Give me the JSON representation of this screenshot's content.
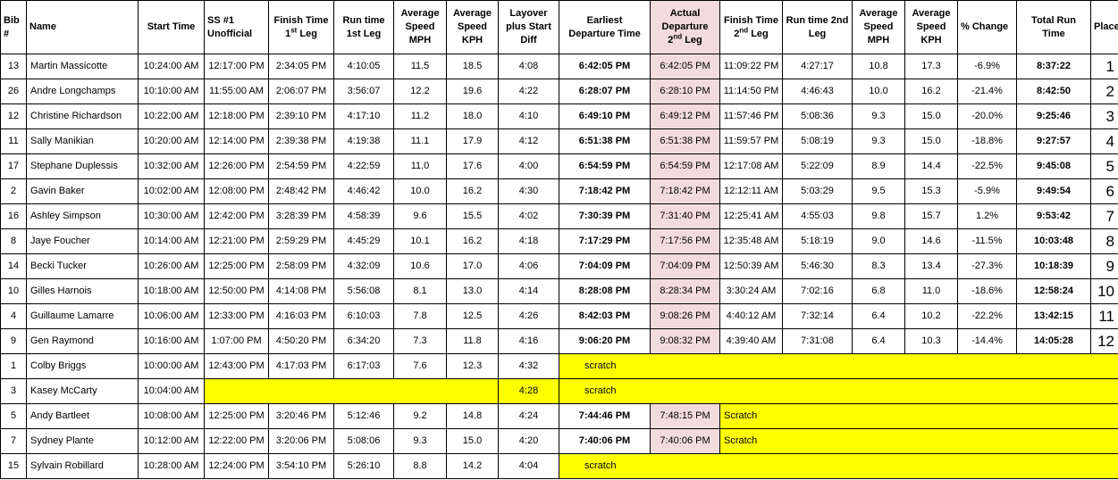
{
  "headers": [
    {
      "line1": "Bib",
      "line2": "#"
    },
    {
      "line1": "Name",
      "line2": ""
    },
    {
      "line1": "Start Time",
      "line2": ""
    },
    {
      "line1": "SS #1",
      "line2": "Unofficial"
    },
    {
      "line1": "Finish Time",
      "line2": "1",
      "sup": "st",
      "rest": " Leg"
    },
    {
      "line1": "Run time",
      "line2": "1st Leg"
    },
    {
      "line1": "Average",
      "line2": "Speed",
      "line3": "MPH"
    },
    {
      "line1": "Average",
      "line2": "Speed",
      "line3": "KPH"
    },
    {
      "line1": "Layover",
      "line2": "plus Start",
      "line3": "Diff"
    },
    {
      "line1": "Earliest",
      "line2": "Departure Time"
    },
    {
      "line1": "Actual",
      "line2": "Departure",
      "line3": "2",
      "sup": "nd",
      "rest": " Leg"
    },
    {
      "line1": "Finish Time",
      "line2": "2",
      "sup": "nd",
      "rest": " Leg"
    },
    {
      "line1": "Run time 2nd",
      "line2": "Leg"
    },
    {
      "line1": "Average",
      "line2": "Speed",
      "line3": "MPH"
    },
    {
      "line1": "Average",
      "line2": "Speed",
      "line3": "KPH"
    },
    {
      "line1": "% Change",
      "line2": ""
    },
    {
      "line1": "Total Run",
      "line2": "Time"
    },
    {
      "line1": "Place",
      "line2": ""
    }
  ],
  "rows": [
    {
      "bib": "13",
      "name": "Martin Massicotte",
      "start": "10:24:00 AM",
      "ss1": "12:17:00 PM",
      "fin1": "2:34:05 PM",
      "run1": "4:10:05",
      "mph1": "11.5",
      "kph1": "18.5",
      "layover": "4:08",
      "earliest": "6:42:05 PM",
      "actual": "6:42:05 PM",
      "fin2": "11:09:22 PM",
      "run2": "4:27:17",
      "mph2": "10.8",
      "kph2": "17.3",
      "change": "-6.9%",
      "total": "8:37:22",
      "place": "1"
    },
    {
      "bib": "26",
      "name": "Andre Longchamps",
      "start": "10:10:00 AM",
      "ss1": "11:55:00 AM",
      "fin1": "2:06:07 PM",
      "run1": "3:56:07",
      "mph1": "12.2",
      "kph1": "19.6",
      "layover": "4:22",
      "earliest": "6:28:07 PM",
      "actual": "6:28:10 PM",
      "fin2": "11:14:50 PM",
      "run2": "4:46:43",
      "mph2": "10.0",
      "kph2": "16.2",
      "change": "-21.4%",
      "total": "8:42:50",
      "place": "2"
    },
    {
      "bib": "12",
      "name": "Christine Richardson",
      "start": "10:22:00 AM",
      "ss1": "12:18:00 PM",
      "fin1": "2:39:10 PM",
      "run1": "4:17:10",
      "mph1": "11.2",
      "kph1": "18.0",
      "layover": "4:10",
      "earliest": "6:49:10 PM",
      "actual": "6:49:12 PM",
      "fin2": "11:57:46 PM",
      "run2": "5:08:36",
      "mph2": "9.3",
      "kph2": "15.0",
      "change": "-20.0%",
      "total": "9:25:46",
      "place": "3"
    },
    {
      "bib": "11",
      "name": "Sally Manikian",
      "start": "10:20:00 AM",
      "ss1": "12:14:00 PM",
      "fin1": "2:39:38 PM",
      "run1": "4:19:38",
      "mph1": "11.1",
      "kph1": "17.9",
      "layover": "4:12",
      "earliest": "6:51:38 PM",
      "actual": "6:51:38 PM",
      "fin2": "11:59:57 PM",
      "run2": "5:08:19",
      "mph2": "9.3",
      "kph2": "15.0",
      "change": "-18.8%",
      "total": "9:27:57",
      "place": "4"
    },
    {
      "bib": "17",
      "name": "Stephane Duplessis",
      "start": "10:32:00 AM",
      "ss1": "12:26:00 PM",
      "fin1": "2:54:59 PM",
      "run1": "4:22:59",
      "mph1": "11.0",
      "kph1": "17.6",
      "layover": "4:00",
      "earliest": "6:54:59 PM",
      "actual": "6:54:59 PM",
      "fin2": "12:17:08 AM",
      "run2": "5:22:09",
      "mph2": "8.9",
      "kph2": "14.4",
      "change": "-22.5%",
      "total": "9:45:08",
      "place": "5"
    },
    {
      "bib": "2",
      "name": "Gavin Baker",
      "start": "10:02:00 AM",
      "ss1": "12:08:00 PM",
      "fin1": "2:48:42 PM",
      "run1": "4:46:42",
      "mph1": "10.0",
      "kph1": "16.2",
      "layover": "4:30",
      "earliest": "7:18:42 PM",
      "actual": "7:18:42 PM",
      "fin2": "12:12:11 AM",
      "run2": "5:03:29",
      "mph2": "9.5",
      "kph2": "15.3",
      "change": "-5.9%",
      "total": "9:49:54",
      "place": "6"
    },
    {
      "bib": "16",
      "name": "Ashley Simpson",
      "start": "10:30:00 AM",
      "ss1": "12:42:00 PM",
      "fin1": "3:28:39 PM",
      "run1": "4:58:39",
      "mph1": "9.6",
      "kph1": "15.5",
      "layover": "4:02",
      "earliest": "7:30:39 PM",
      "actual": "7:31:40 PM",
      "fin2": "12:25:41 AM",
      "run2": "4:55:03",
      "mph2": "9.8",
      "kph2": "15.7",
      "change": "1.2%",
      "total": "9:53:42",
      "place": "7"
    },
    {
      "bib": "8",
      "name": "Jaye Foucher",
      "start": "10:14:00 AM",
      "ss1": "12:21:00 PM",
      "fin1": "2:59:29 PM",
      "run1": "4:45:29",
      "mph1": "10.1",
      "kph1": "16.2",
      "layover": "4:18",
      "earliest": "7:17:29 PM",
      "actual": "7:17:56 PM",
      "fin2": "12:35:48 AM",
      "run2": "5:18:19",
      "mph2": "9.0",
      "kph2": "14.6",
      "change": "-11.5%",
      "total": "10:03:48",
      "place": "8"
    },
    {
      "bib": "14",
      "name": "Becki Tucker",
      "start": "10:26:00 AM",
      "ss1": "12:25:00 PM",
      "fin1": "2:58:09 PM",
      "run1": "4:32:09",
      "mph1": "10.6",
      "kph1": "17.0",
      "layover": "4:06",
      "earliest": "7:04:09 PM",
      "actual": "7:04:09 PM",
      "fin2": "12:50:39 AM",
      "run2": "5:46:30",
      "mph2": "8.3",
      "kph2": "13.4",
      "change": "-27.3%",
      "total": "10:18:39",
      "place": "9"
    },
    {
      "bib": "10",
      "name": "Gilles Harnois",
      "start": "10:18:00 AM",
      "ss1": "12:50:00 PM",
      "fin1": "4:14:08 PM",
      "run1": "5:56:08",
      "mph1": "8.1",
      "kph1": "13.0",
      "layover": "4:14",
      "earliest": "8:28:08 PM",
      "actual": "8:28:34 PM",
      "fin2": "3:30:24 AM",
      "run2": "7:02:16",
      "mph2": "6.8",
      "kph2": "11.0",
      "change": "-18.6%",
      "total": "12:58:24",
      "place": "10"
    },
    {
      "bib": "4",
      "name": "Guillaume Lamarre",
      "start": "10:06:00 AM",
      "ss1": "12:33:00 PM",
      "fin1": "4:16:03 PM",
      "run1": "6:10:03",
      "mph1": "7.8",
      "kph1": "12.5",
      "layover": "4:26",
      "earliest": "8:42:03 PM",
      "actual": "9:08:26 PM",
      "fin2": "4:40:12 AM",
      "run2": "7:32:14",
      "mph2": "6.4",
      "kph2": "10.2",
      "change": "-22.2%",
      "total": "13:42:15",
      "place": "11"
    },
    {
      "bib": "9",
      "name": "Gen Raymond",
      "start": "10:16:00 AM",
      "ss1": "1:07:00 PM",
      "fin1": "4:50:20 PM",
      "run1": "6:34:20",
      "mph1": "7.3",
      "kph1": "11.8",
      "layover": "4:16",
      "earliest": "9:06:20 PM",
      "actual": "9:08:32 PM",
      "fin2": "4:39:40 AM",
      "run2": "7:31:08",
      "mph2": "6.4",
      "kph2": "10.3",
      "change": "-14.4%",
      "total": "14:05:28",
      "place": "12"
    }
  ],
  "dnf_rows": [
    {
      "bib": "1",
      "name": "Colby Briggs",
      "start": "10:00:00 AM",
      "ss1": "12:43:00 PM",
      "fin1": "4:17:03 PM",
      "run1": "6:17:03",
      "mph1": "7.6",
      "kph1": "12.3",
      "layover": "4:32",
      "status": "scratch"
    },
    {
      "bib": "3",
      "name": "Kasey McCarty",
      "start": "10:04:00 AM",
      "layover": "4:28",
      "status": "scratch"
    },
    {
      "bib": "5",
      "name": "Andy Bartleet",
      "start": "10:08:00 AM",
      "ss1": "12:25:00 PM",
      "fin1": "3:20:46 PM",
      "run1": "5:12:46",
      "mph1": "9.2",
      "kph1": "14.8",
      "layover": "4:24",
      "earliest": "7:44:46 PM",
      "actual": "7:48:15 PM",
      "status": "Scratch"
    },
    {
      "bib": "7",
      "name": "Sydney Plante",
      "start": "10:12:00 AM",
      "ss1": "12:22:00 PM",
      "fin1": "3:20:06 PM",
      "run1": "5:08:06",
      "mph1": "9.3",
      "kph1": "15.0",
      "layover": "4:20",
      "earliest": "7:40:06 PM",
      "actual": "7:40:06 PM",
      "status": "Scratch"
    },
    {
      "bib": "15",
      "name": "Sylvain Robillard",
      "start": "10:28:00 AM",
      "ss1": "12:24:00 PM",
      "fin1": "3:54:10 PM",
      "run1": "5:26:10",
      "mph1": "8.8",
      "kph1": "14.2",
      "layover": "4:04",
      "status": "scratch"
    }
  ],
  "colors": {
    "highlight_pink": "#f2dcdb",
    "highlight_yellow": "#ffff00"
  }
}
